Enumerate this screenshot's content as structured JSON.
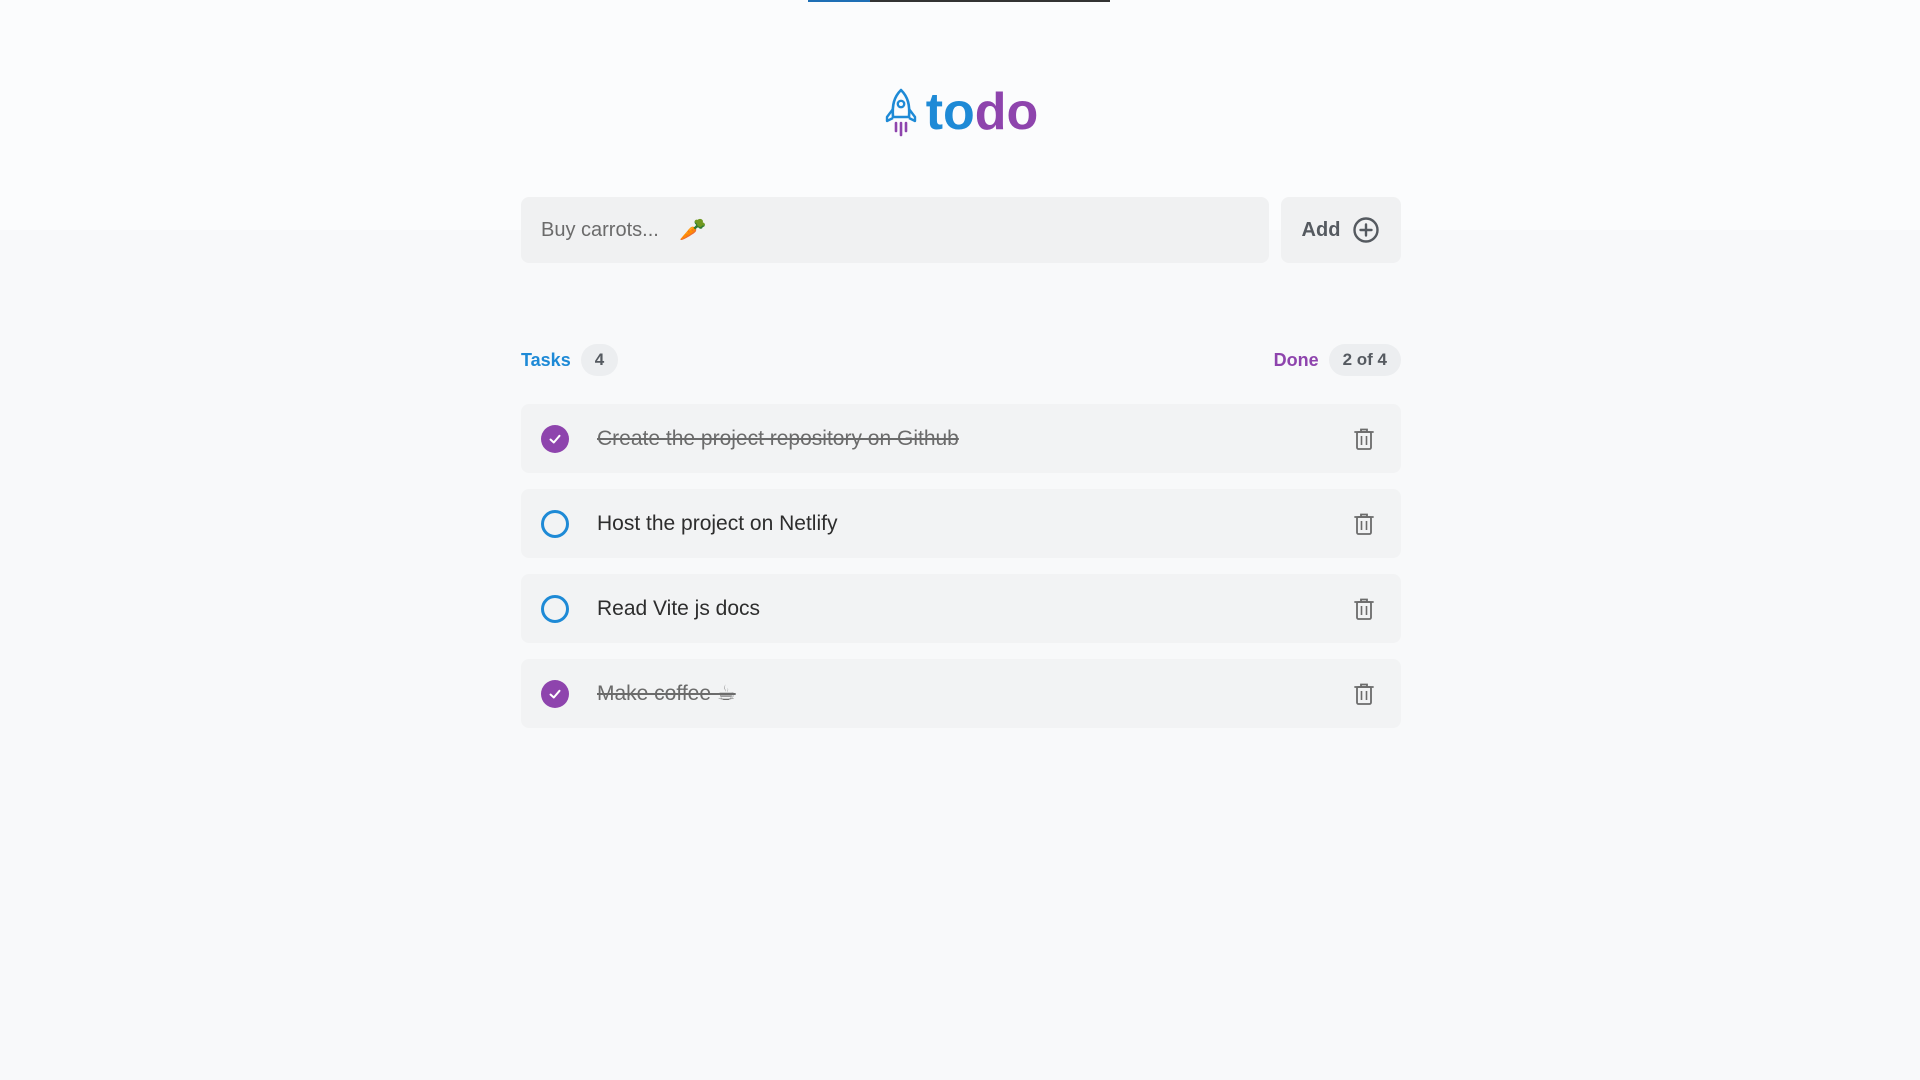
{
  "app": {
    "logo_icon": "rocket-icon",
    "title_part1": "to",
    "title_part2": "do"
  },
  "form": {
    "placeholder": "Buy carrots...",
    "placeholder_emoji": "🥕",
    "add_label": "Add",
    "add_icon": "plus-circle-icon"
  },
  "stats": {
    "tasks_label": "Tasks",
    "tasks_count": "4",
    "done_label": "Done",
    "done_count": "2 of 4"
  },
  "tasks": [
    {
      "text": "Create the project repository on Github",
      "completed": true
    },
    {
      "text": "Host the project on Netlify",
      "completed": false
    },
    {
      "text": "Read Vite js docs",
      "completed": false
    },
    {
      "text": "Make coffee ☕",
      "completed": true
    }
  ],
  "colors": {
    "primary_blue": "#1e8ad6",
    "accent_purple": "#8e44ad",
    "background": "#f8f9fa",
    "card": "#f2f3f4"
  }
}
